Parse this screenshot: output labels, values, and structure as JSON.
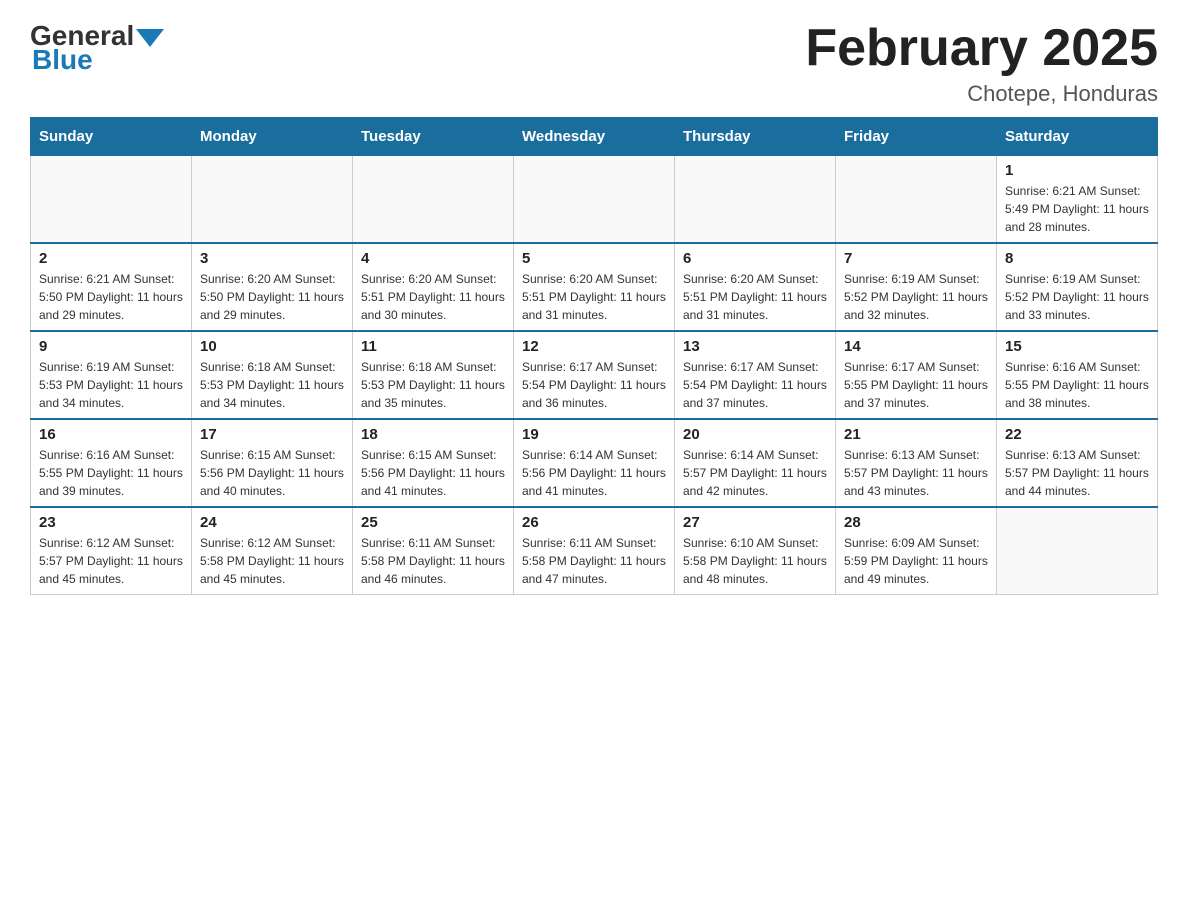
{
  "header": {
    "logo_text1": "General",
    "logo_text2": "Blue",
    "title": "February 2025",
    "subtitle": "Chotepe, Honduras"
  },
  "days_of_week": [
    "Sunday",
    "Monday",
    "Tuesday",
    "Wednesday",
    "Thursday",
    "Friday",
    "Saturday"
  ],
  "weeks": [
    [
      {
        "day": "",
        "info": ""
      },
      {
        "day": "",
        "info": ""
      },
      {
        "day": "",
        "info": ""
      },
      {
        "day": "",
        "info": ""
      },
      {
        "day": "",
        "info": ""
      },
      {
        "day": "",
        "info": ""
      },
      {
        "day": "1",
        "info": "Sunrise: 6:21 AM\nSunset: 5:49 PM\nDaylight: 11 hours\nand 28 minutes."
      }
    ],
    [
      {
        "day": "2",
        "info": "Sunrise: 6:21 AM\nSunset: 5:50 PM\nDaylight: 11 hours\nand 29 minutes."
      },
      {
        "day": "3",
        "info": "Sunrise: 6:20 AM\nSunset: 5:50 PM\nDaylight: 11 hours\nand 29 minutes."
      },
      {
        "day": "4",
        "info": "Sunrise: 6:20 AM\nSunset: 5:51 PM\nDaylight: 11 hours\nand 30 minutes."
      },
      {
        "day": "5",
        "info": "Sunrise: 6:20 AM\nSunset: 5:51 PM\nDaylight: 11 hours\nand 31 minutes."
      },
      {
        "day": "6",
        "info": "Sunrise: 6:20 AM\nSunset: 5:51 PM\nDaylight: 11 hours\nand 31 minutes."
      },
      {
        "day": "7",
        "info": "Sunrise: 6:19 AM\nSunset: 5:52 PM\nDaylight: 11 hours\nand 32 minutes."
      },
      {
        "day": "8",
        "info": "Sunrise: 6:19 AM\nSunset: 5:52 PM\nDaylight: 11 hours\nand 33 minutes."
      }
    ],
    [
      {
        "day": "9",
        "info": "Sunrise: 6:19 AM\nSunset: 5:53 PM\nDaylight: 11 hours\nand 34 minutes."
      },
      {
        "day": "10",
        "info": "Sunrise: 6:18 AM\nSunset: 5:53 PM\nDaylight: 11 hours\nand 34 minutes."
      },
      {
        "day": "11",
        "info": "Sunrise: 6:18 AM\nSunset: 5:53 PM\nDaylight: 11 hours\nand 35 minutes."
      },
      {
        "day": "12",
        "info": "Sunrise: 6:17 AM\nSunset: 5:54 PM\nDaylight: 11 hours\nand 36 minutes."
      },
      {
        "day": "13",
        "info": "Sunrise: 6:17 AM\nSunset: 5:54 PM\nDaylight: 11 hours\nand 37 minutes."
      },
      {
        "day": "14",
        "info": "Sunrise: 6:17 AM\nSunset: 5:55 PM\nDaylight: 11 hours\nand 37 minutes."
      },
      {
        "day": "15",
        "info": "Sunrise: 6:16 AM\nSunset: 5:55 PM\nDaylight: 11 hours\nand 38 minutes."
      }
    ],
    [
      {
        "day": "16",
        "info": "Sunrise: 6:16 AM\nSunset: 5:55 PM\nDaylight: 11 hours\nand 39 minutes."
      },
      {
        "day": "17",
        "info": "Sunrise: 6:15 AM\nSunset: 5:56 PM\nDaylight: 11 hours\nand 40 minutes."
      },
      {
        "day": "18",
        "info": "Sunrise: 6:15 AM\nSunset: 5:56 PM\nDaylight: 11 hours\nand 41 minutes."
      },
      {
        "day": "19",
        "info": "Sunrise: 6:14 AM\nSunset: 5:56 PM\nDaylight: 11 hours\nand 41 minutes."
      },
      {
        "day": "20",
        "info": "Sunrise: 6:14 AM\nSunset: 5:57 PM\nDaylight: 11 hours\nand 42 minutes."
      },
      {
        "day": "21",
        "info": "Sunrise: 6:13 AM\nSunset: 5:57 PM\nDaylight: 11 hours\nand 43 minutes."
      },
      {
        "day": "22",
        "info": "Sunrise: 6:13 AM\nSunset: 5:57 PM\nDaylight: 11 hours\nand 44 minutes."
      }
    ],
    [
      {
        "day": "23",
        "info": "Sunrise: 6:12 AM\nSunset: 5:57 PM\nDaylight: 11 hours\nand 45 minutes."
      },
      {
        "day": "24",
        "info": "Sunrise: 6:12 AM\nSunset: 5:58 PM\nDaylight: 11 hours\nand 45 minutes."
      },
      {
        "day": "25",
        "info": "Sunrise: 6:11 AM\nSunset: 5:58 PM\nDaylight: 11 hours\nand 46 minutes."
      },
      {
        "day": "26",
        "info": "Sunrise: 6:11 AM\nSunset: 5:58 PM\nDaylight: 11 hours\nand 47 minutes."
      },
      {
        "day": "27",
        "info": "Sunrise: 6:10 AM\nSunset: 5:58 PM\nDaylight: 11 hours\nand 48 minutes."
      },
      {
        "day": "28",
        "info": "Sunrise: 6:09 AM\nSunset: 5:59 PM\nDaylight: 11 hours\nand 49 minutes."
      },
      {
        "day": "",
        "info": ""
      }
    ]
  ]
}
